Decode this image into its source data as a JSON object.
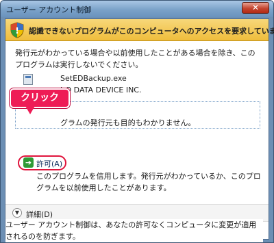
{
  "window": {
    "title": "ユーザー アカウント制御",
    "close_label": "✕"
  },
  "banner": {
    "message": "認識できないプログラムがこのコンピュータへのアクセスを要求しています",
    "icon": "shield-icon"
  },
  "intro": {
    "text": "発行元がわかっている場合や以前使用したことがある場合を除き、このプログラムは実行しないでください。"
  },
  "program": {
    "name": "SetEDBackup.exe",
    "publisher": "I-O DATA DEVICE INC.",
    "icon": "application-icon"
  },
  "options": {
    "warning": "グラムの発行元も目的もわかりません。",
    "allow_label": "許可(A)",
    "allow_description": "このプログラムを信用します。発行元がわかっているか、このプログラムを以前使用したことがあります。",
    "allow_icon": "arrow-right-icon"
  },
  "annotation": {
    "callout": "クリック"
  },
  "details": {
    "label": "詳細(D)",
    "icon": "chevron-down-icon"
  },
  "footer": {
    "text": "ユーザー アカウント制御は、あなたの許可なくコンピュータに変更が適用されるのを防ぎます。"
  },
  "colors": {
    "banner": "#efbd3c",
    "callout": "#ee1c56",
    "allow_arrow": "#2e9a35",
    "title_bar": "#7ba2c9"
  }
}
